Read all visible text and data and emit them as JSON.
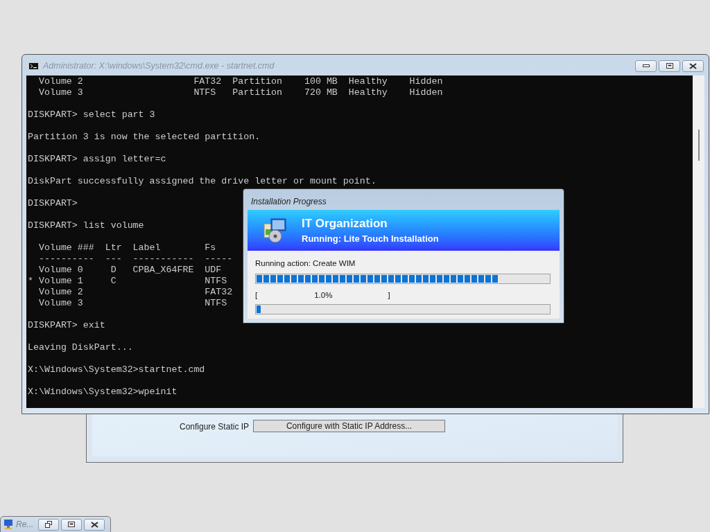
{
  "console_window": {
    "title": "Administrator: X:\\windows\\System32\\cmd.exe - startnet.cmd",
    "blocks": [
      [
        "  Volume 2                    FAT32  Partition    100 MB  Healthy    Hidden",
        "  Volume 3                    NTFS   Partition    720 MB  Healthy    Hidden"
      ],
      [
        "DISKPART> select part 3"
      ],
      [
        "Partition 3 is now the selected partition."
      ],
      [
        "DISKPART> assign letter=c"
      ],
      [
        "DiskPart successfully assigned the drive letter or mount point."
      ],
      [
        "DISKPART>"
      ],
      [
        "DISKPART> list volume"
      ],
      [
        "  Volume ###  Ltr  Label        Fs",
        "  ----------  ---  -----------  -----",
        "  Volume 0     D   CPBA_X64FRE  UDF",
        "* Volume 1     C                NTFS",
        "  Volume 2                      FAT32",
        "  Volume 3                      NTFS"
      ],
      [
        "DISKPART> exit"
      ],
      [
        "Leaving DiskPart..."
      ],
      [
        "X:\\Windows\\System32>startnet.cmd"
      ],
      [
        "X:\\Windows\\System32>wpeinit"
      ]
    ]
  },
  "progress_dialog": {
    "title": "Installation Progress",
    "heading": "IT Organization",
    "subheading": "Running: Lite Touch Installation",
    "action": "Running action: Create WIM",
    "overall": {
      "level": 0.83
    },
    "step": {
      "open_bracket": "[",
      "percent": "1.0%",
      "close_bracket": "]",
      "level": 0.015
    }
  },
  "background_window": {
    "label": "Configure Static IP",
    "button": "Configure with Static IP Address..."
  },
  "minimized_window": {
    "title": "Re..."
  }
}
